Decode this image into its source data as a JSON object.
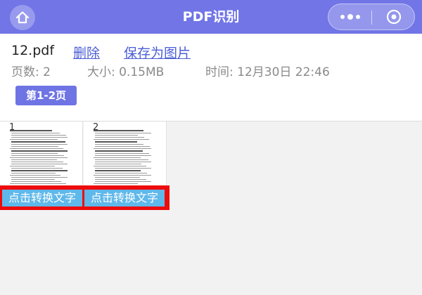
{
  "topbar": {
    "title": "PDF识别",
    "accent": "#7175e6",
    "home_icon": "home-icon",
    "more_icon": "more-dots-icon",
    "close_icon": "target-close-icon"
  },
  "file": {
    "name": "12.pdf",
    "delete_label": "删除",
    "save_label": "保存为图片",
    "pages": "页数: 2",
    "size": "大小: 0.15MB",
    "time": "时间: 12月30日 22:46",
    "range_label": "第1-2页"
  },
  "pages": [
    {
      "number": "1",
      "action": "点击转换文字"
    },
    {
      "number": "2",
      "action": "点击转换文字"
    }
  ],
  "colors": {
    "link": "#4b5dd6",
    "button": "#5fb8ea",
    "highlight": "#ee0b0b"
  }
}
